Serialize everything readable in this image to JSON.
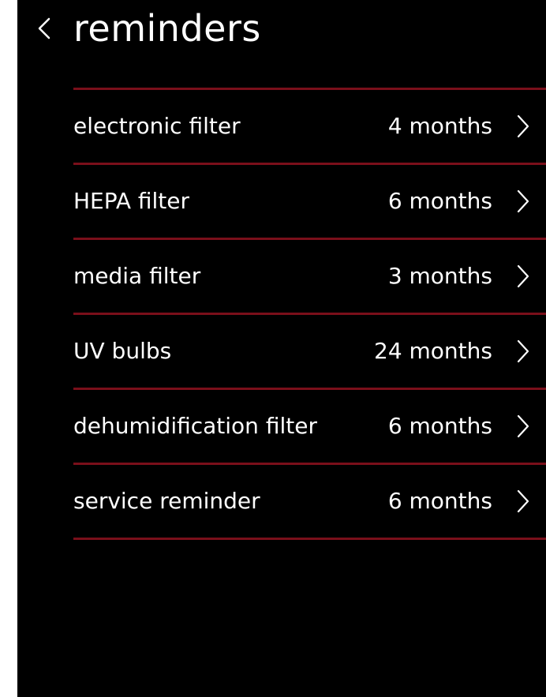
{
  "colors": {
    "background": "#000000",
    "text": "#ffffff",
    "divider": "#7a0f1a"
  },
  "header": {
    "back_icon": "chevron-left-icon",
    "title": "reminders"
  },
  "reminders": [
    {
      "label": "electronic filter",
      "value": "4 months",
      "icon": "chevron-right-icon"
    },
    {
      "label": "HEPA filter",
      "value": "6 months",
      "icon": "chevron-right-icon"
    },
    {
      "label": "media filter",
      "value": "3 months",
      "icon": "chevron-right-icon"
    },
    {
      "label": "UV bulbs",
      "value": "24 months",
      "icon": "chevron-right-icon"
    },
    {
      "label": "dehumidification filter",
      "value": "6 months",
      "icon": "chevron-right-icon"
    },
    {
      "label": "service reminder",
      "value": "6 months",
      "icon": "chevron-right-icon"
    }
  ]
}
